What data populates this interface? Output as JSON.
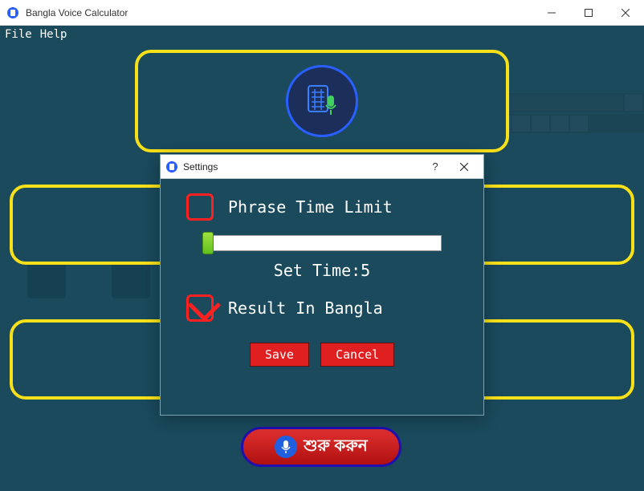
{
  "window": {
    "title": "Bangla Voice Calculator"
  },
  "menu": {
    "file": "File",
    "help": "Help"
  },
  "start": {
    "label": "শুরু করুন"
  },
  "dialog": {
    "title": "Settings",
    "phrase_time_limit": "Phrase Time Limit",
    "set_time_label": "Set Time:5",
    "slider_value": 5,
    "result_in_bangla": "Result In Bangla",
    "phrase_checked": false,
    "result_checked": true,
    "save": "Save",
    "cancel": "Cancel"
  }
}
